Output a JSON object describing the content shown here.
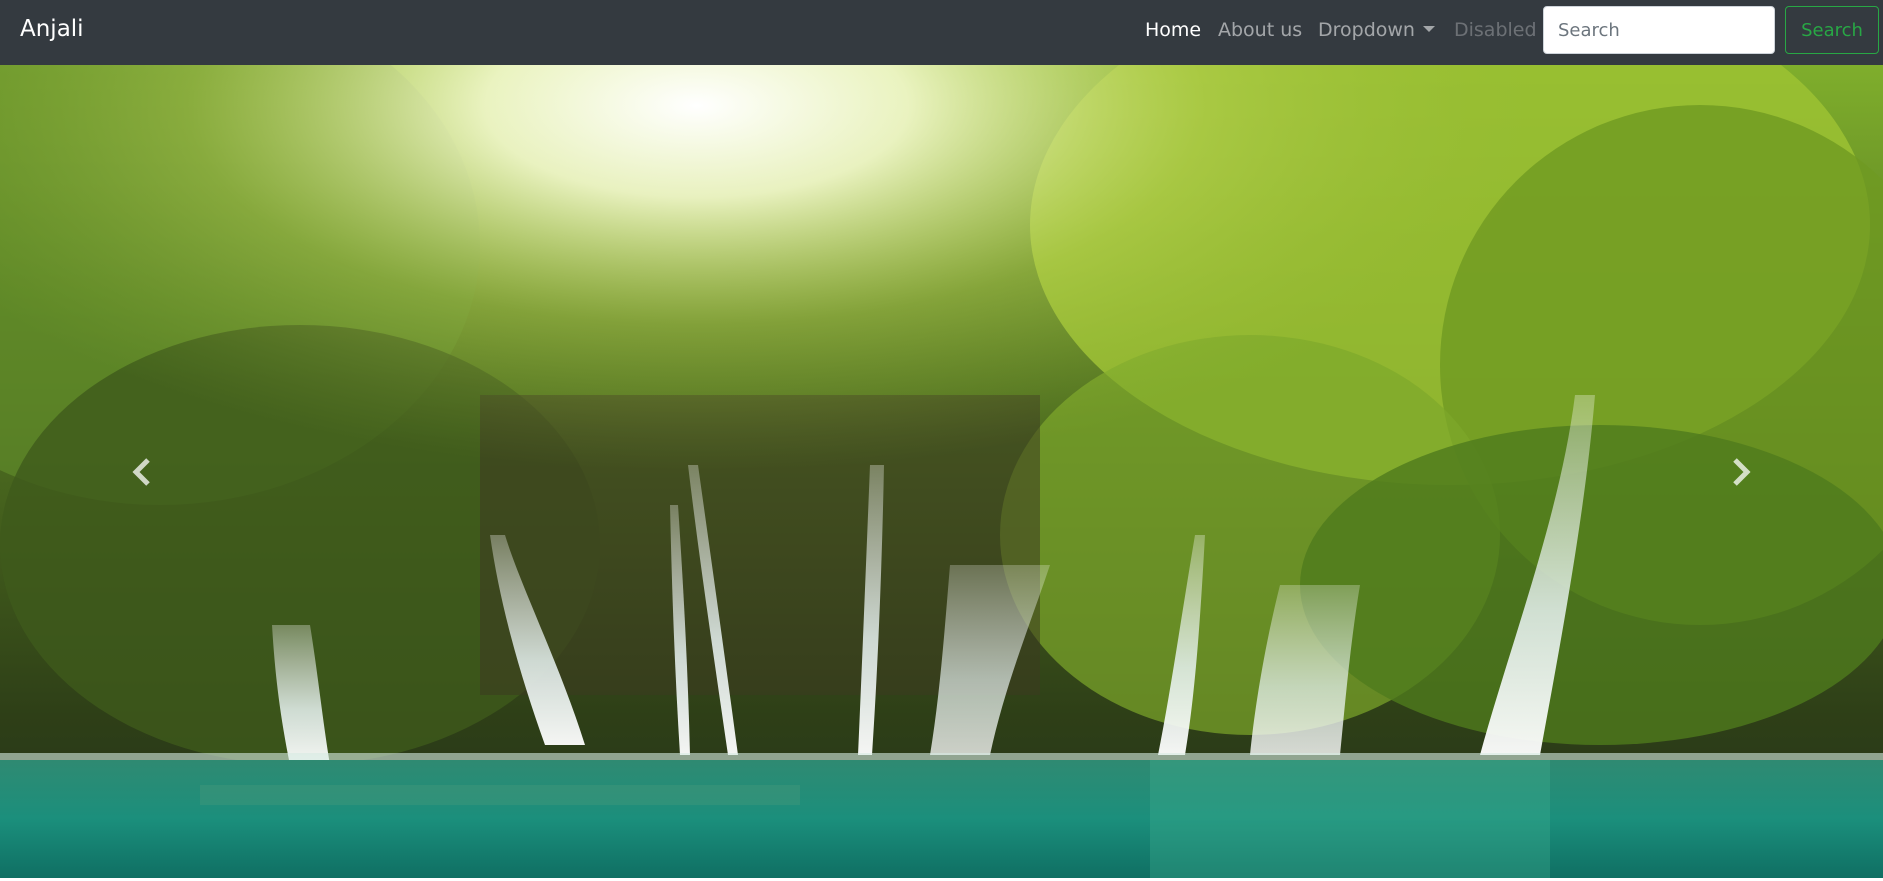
{
  "navbar": {
    "brand": "Anjali",
    "links": [
      {
        "label": "Home",
        "state": "active"
      },
      {
        "label": "About us",
        "state": "normal"
      },
      {
        "label": "Dropdown",
        "state": "dropdown"
      },
      {
        "label": "Disabled",
        "state": "disabled"
      }
    ],
    "search": {
      "placeholder": "Search",
      "value": "",
      "button_label": "Search"
    }
  },
  "carousel": {
    "controls": {
      "prev_icon": "chevron-left-icon",
      "next_icon": "chevron-right-icon"
    }
  },
  "colors": {
    "navbar_bg": "#343a40",
    "success": "#28a745"
  }
}
